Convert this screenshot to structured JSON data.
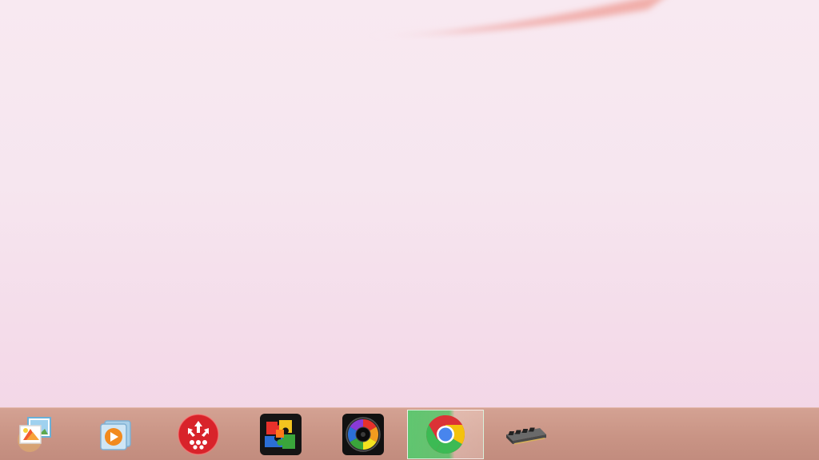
{
  "taskbar": {
    "items": [
      {
        "name": "photo-gallery",
        "icon": "photo-gallery-icon",
        "active": false
      },
      {
        "name": "media-player",
        "icon": "media-player-icon",
        "active": false
      },
      {
        "name": "network-share",
        "icon": "network-share-icon",
        "active": false
      },
      {
        "name": "puzzle-app",
        "icon": "puzzle-icon",
        "active": false
      },
      {
        "name": "camera-app",
        "icon": "camera-lens-icon",
        "active": false
      },
      {
        "name": "chrome",
        "icon": "chrome-icon",
        "active": true
      },
      {
        "name": "memory-module",
        "icon": "memory-chip-icon",
        "active": false
      }
    ]
  },
  "colors": {
    "desktop_top": "#f8e9f1",
    "desktop_bottom": "#f3d7e7",
    "taskbar": "#c99485",
    "active_highlight": "#5ac86e"
  }
}
